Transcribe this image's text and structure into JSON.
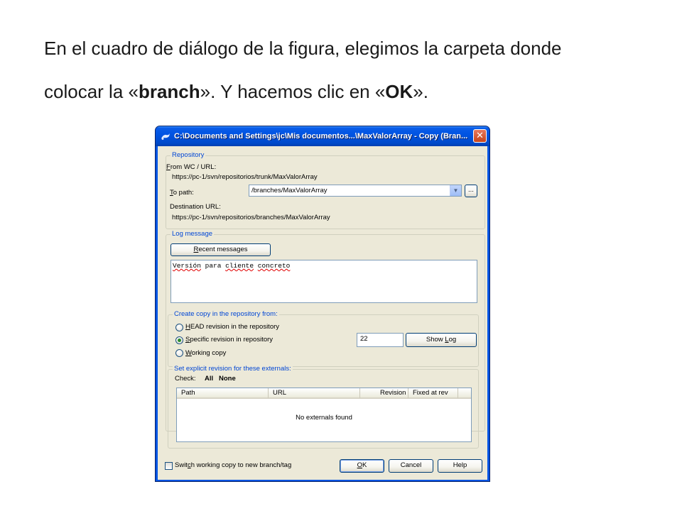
{
  "slide": {
    "line1": "En el cuadro de diálogo de la figura, elegimos la carpeta donde",
    "line2_pre": "colocar la «",
    "line2_bold1": "branch",
    "line2_mid": "». Y hacemos clic en «",
    "line2_bold2": "OK",
    "line2_post": "»."
  },
  "dialog": {
    "title": "C:\\Documents and Settings\\jc\\Mis documentos...\\MaxValorArray - Copy (Bran...",
    "close_label": "✕",
    "repository": {
      "group_label": "Repository",
      "from_label_u": "F",
      "from_label_rest": "rom WC / URL:",
      "from_value": "https://pc-1/svn/repositorios/trunk/MaxValorArray",
      "to_label_u": "T",
      "to_label_rest": "o path:",
      "to_value": "/branches/MaxValorArray",
      "browse_label": "...",
      "dest_label": "Destination URL:",
      "dest_value": "https://pc-1/svn/repositorios/branches/MaxValorArray"
    },
    "log": {
      "group_label": "Log message",
      "recent_u": "R",
      "recent_rest": "ecent messages",
      "message_w1": "Versión",
      "message_w2": "para",
      "message_w3": "cliente",
      "message_w4": "concreto"
    },
    "copy_from": {
      "group_label": "Create copy in the repository from:",
      "options": [
        {
          "u": "H",
          "rest": "EAD revision in the repository",
          "checked": false
        },
        {
          "u": "S",
          "rest": "pecific revision in repository",
          "checked": true
        },
        {
          "u": "W",
          "rest": "orking copy",
          "checked": false
        }
      ],
      "revision_value": "22",
      "show_log_pre": "Show ",
      "show_log_u": "L",
      "show_log_rest": "og"
    },
    "externals": {
      "group_label": "Set explicit revision for these externals:",
      "check_label": "Check:",
      "all_label": "All",
      "none_label": "None",
      "columns": [
        "Path",
        "URL",
        "Revision",
        "Fixed at rev"
      ],
      "empty_text": "No externals found"
    },
    "switch_pre": "Swit",
    "switch_u": "c",
    "switch_rest": "h working copy to new branch/tag",
    "buttons": {
      "ok_u": "O",
      "ok_rest": "K",
      "cancel": "Cancel",
      "help": "Help"
    }
  }
}
